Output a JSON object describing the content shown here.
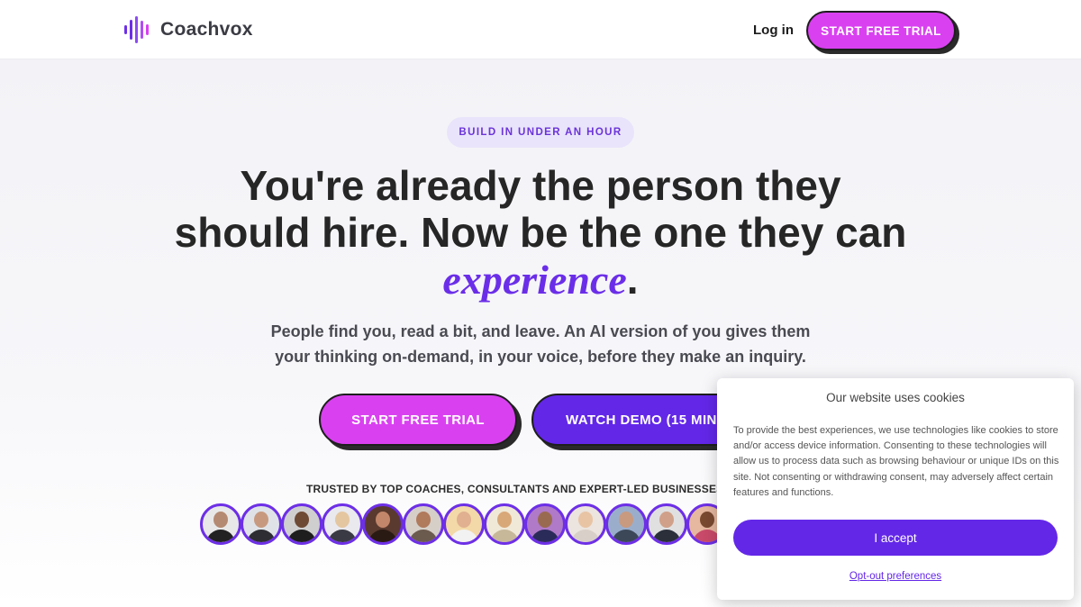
{
  "header": {
    "logo_text": "Coachvox",
    "login_label": "Log in",
    "cta_label": "START FREE TRIAL"
  },
  "hero": {
    "badge": "BUILD IN UNDER AN HOUR",
    "headline_line1": "You're already the person they",
    "headline_line2": "should hire. Now be the one they can",
    "headline_accent": "experience",
    "headline_period": ".",
    "subtext_line1": "People find you, read a bit, and leave. An AI version of you gives them",
    "subtext_line2": "your thinking on-demand, in your voice, before they make an inquiry.",
    "primary_cta": "START FREE TRIAL",
    "secondary_cta": "WATCH DEMO (15 MINS)",
    "trusted_text": "TRUSTED BY TOP COACHES, CONSULTANTS AND EXPERT-LED BUSINESSES IN"
  },
  "cookie": {
    "title": "Our website uses cookies",
    "body": "To provide the best experiences, we use technologies like cookies to store and/or access device information. Consenting to these technologies will allow us to process data such as browsing behaviour or unique IDs on this site. Not consenting or withdrawing consent, may adversely affect certain features and functions.",
    "accept_label": "I accept",
    "optout_label": "Opt-out preferences"
  },
  "colors": {
    "brand_purple": "#6327e8",
    "brand_magenta": "#d941f0",
    "badge_bg": "#e9e4fb"
  },
  "icons": {
    "logo": "soundwave-logo-icon"
  }
}
